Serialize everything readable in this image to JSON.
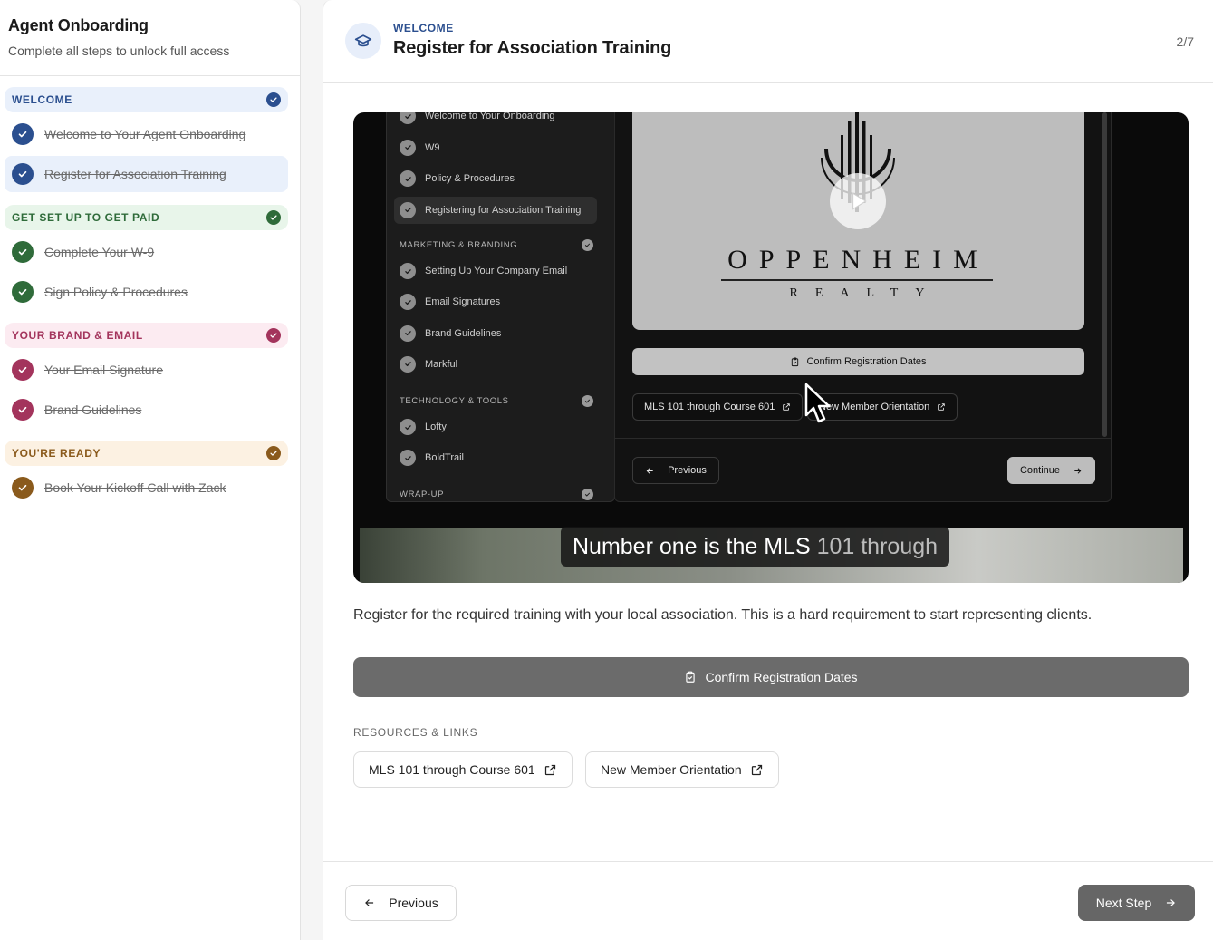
{
  "sidebar": {
    "title": "Agent Onboarding",
    "subtitle": "Complete all steps to unlock full access",
    "sections": [
      {
        "label": "WELCOME",
        "color": "#2b4f8f",
        "bg": "#e9f0fb",
        "items": [
          {
            "label": "Welcome to Your Agent Onboarding"
          },
          {
            "label": "Register for Association Training",
            "active": true
          }
        ]
      },
      {
        "label": "GET SET UP TO GET PAID",
        "color": "#2f6b3a",
        "bg": "#e8f5ea",
        "items": [
          {
            "label": "Complete Your W-9"
          },
          {
            "label": "Sign Policy & Procedures"
          }
        ]
      },
      {
        "label": "YOUR BRAND & EMAIL",
        "color": "#a3345c",
        "bg": "#fcebf1",
        "items": [
          {
            "label": "Your Email Signature"
          },
          {
            "label": "Brand Guidelines"
          }
        ]
      },
      {
        "label": "YOU'RE READY",
        "color": "#8a5a1c",
        "bg": "#fcf1e2",
        "items": [
          {
            "label": "Book Your Kickoff Call with Zack"
          }
        ]
      }
    ]
  },
  "header": {
    "kicker": "WELCOME",
    "title": "Register for Association Training",
    "step_count": "2/7",
    "icon": "graduation-cap-icon"
  },
  "video": {
    "side_rows": [
      {
        "label": "Welcome to Your Onboarding"
      },
      {
        "label": "W9"
      },
      {
        "label": "Policy & Procedures"
      },
      {
        "label": "Registering for Association Training",
        "active": true
      }
    ],
    "side_sections": [
      {
        "label": "MARKETING & BRANDING",
        "rows": [
          "Setting Up Your Company Email",
          "Email Signatures",
          "Brand Guidelines",
          "Markful"
        ]
      },
      {
        "label": "TECHNOLOGY & TOOLS",
        "rows": [
          "Lofty",
          "BoldTrail"
        ]
      },
      {
        "label": "WRAP-UP",
        "rows": []
      }
    ],
    "brand_name": "OPPENHEIM",
    "brand_sub": "REALTY",
    "confirm_label": "Confirm Registration Dates",
    "link1": "MLS 101 through Course 601",
    "link2": "New Member Orientation",
    "prev_label": "Previous",
    "continue_label": "Continue",
    "caption_main": "Number one is the MLS",
    "caption_dim": "101 through"
  },
  "main": {
    "description": "Register for the required training with your local association. This is a hard requirement to start representing clients.",
    "confirm_button": "Confirm Registration Dates",
    "resources_heading": "RESOURCES & LINKS",
    "resources": [
      "MLS 101 through Course 601",
      "New Member Orientation"
    ]
  },
  "footer": {
    "previous": "Previous",
    "next": "Next Step"
  }
}
